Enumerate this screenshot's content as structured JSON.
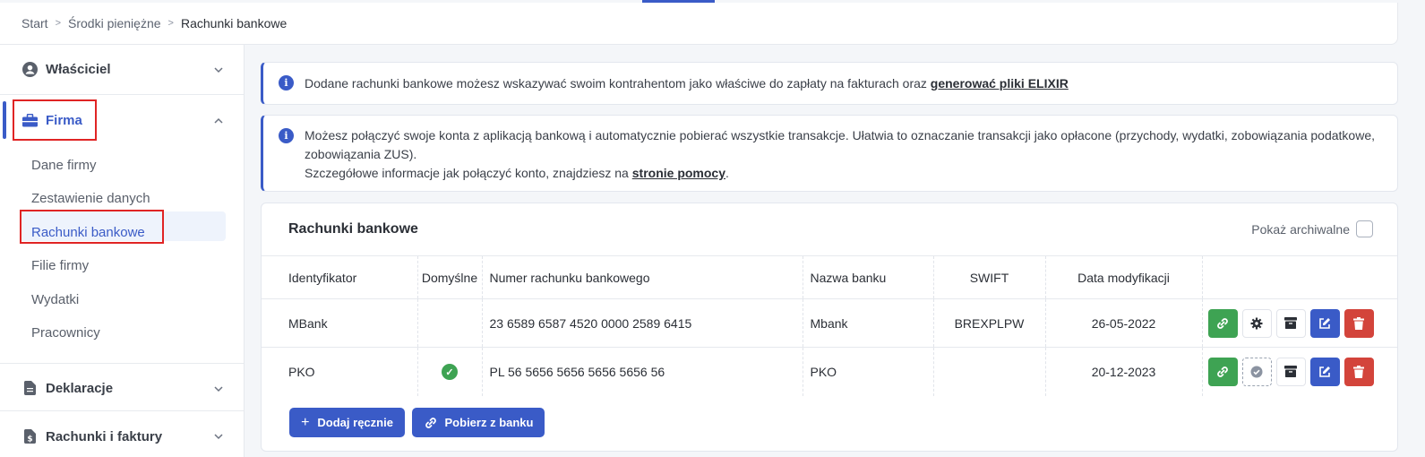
{
  "breadcrumb": {
    "items": [
      "Start",
      "Środki pieniężne",
      "Rachunki bankowe"
    ]
  },
  "sidebar": {
    "owner": "Właściciel",
    "company": "Firma",
    "company_items": [
      "Dane firmy",
      "Zestawienie danych",
      "Rachunki bankowe",
      "Filie firmy",
      "Wydatki",
      "Pracownicy"
    ],
    "declarations": "Deklaracje",
    "invoices": "Rachunki i faktury"
  },
  "alerts": {
    "first_text": "Dodane rachunki bankowe możesz wskazywać swoim kontrahentom jako właściwe do zapłaty na fakturach oraz",
    "first_link": "generować pliki ELIXIR",
    "second_line1": "Możesz połączyć swoje konta z aplikacją bankową i automatycznie pobierać wszystkie transakcje. Ułatwia to oznaczanie transakcji jako opłacone (przychody, wydatki, zobowiązania podatkowe,",
    "second_line2": "zobowiązania ZUS).",
    "second_line3": "Szczegółowe informacje jak połączyć konto, znajdziesz na",
    "second_link": "stronie pomocy",
    "second_after": "."
  },
  "card": {
    "title": "Rachunki bankowe",
    "show_archived": "Pokaż archiwalne"
  },
  "table": {
    "headers": [
      "Identyfikator",
      "Domyślne",
      "Numer rachunku bankowego",
      "Nazwa banku",
      "SWIFT",
      "Data modyfikacji"
    ],
    "rows": [
      {
        "id": "MBank",
        "default": false,
        "number": "23 6589 6587 4520 0000 2589 6415",
        "bank": "Mbank",
        "swift": "BREXPLPW",
        "date": "26-05-2022"
      },
      {
        "id": "PKO",
        "default": true,
        "number": "PL 56 5656 5656 5656 5656 56",
        "bank": "PKO",
        "swift": "",
        "date": "20-12-2023"
      }
    ]
  },
  "buttons": {
    "add_manual": "Dodaj ręcznie",
    "fetch_bank": "Pobierz z banku"
  },
  "colors": {
    "accent": "#3a5bc7",
    "success": "#3ea353",
    "danger": "#d3443b",
    "highlight": "#e02424"
  }
}
